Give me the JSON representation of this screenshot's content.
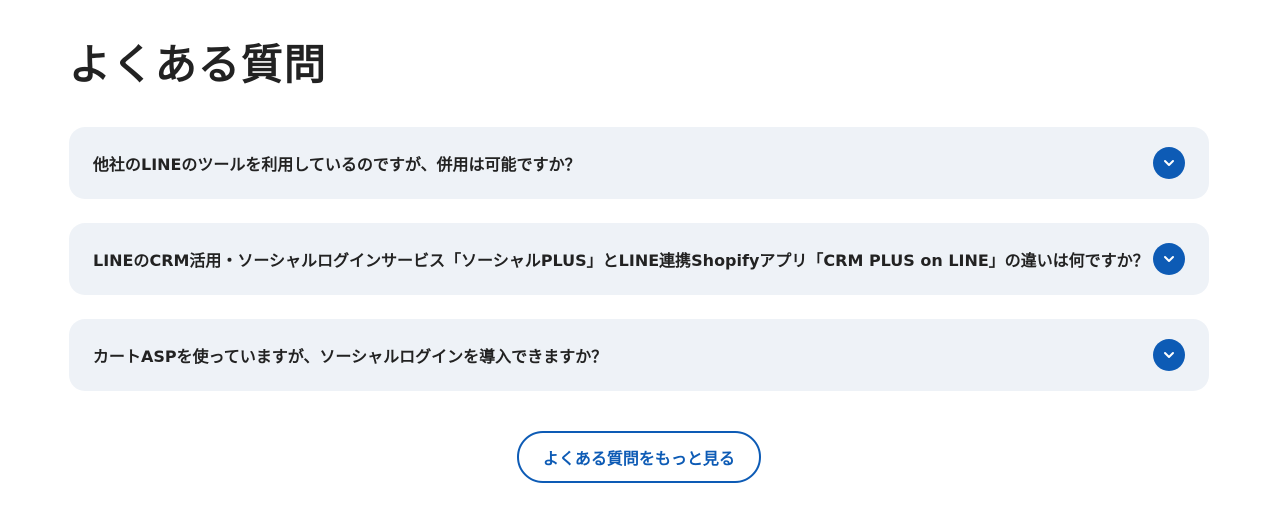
{
  "faq": {
    "title": "よくある質問",
    "items": [
      {
        "question": "他社のLINEのツールを利用しているのですが、併用は可能ですか？",
        "icon": "chevron-down-icon"
      },
      {
        "question": "LINEのCRM活用・ソーシャルログインサービス「ソーシャルPLUS」とLINE連携Shopifyアプリ「CRM PLUS on LINE」の違いは何ですか？",
        "icon": "chevron-down-icon"
      },
      {
        "question": "カートASPを使っていますが、ソーシャルログインを導入できますか？",
        "icon": "chevron-down-icon"
      }
    ],
    "more_label": "よくある質問をもっと見る"
  },
  "colors": {
    "accent": "#0d5bb5",
    "item_background": "#eef2f7",
    "text": "#222222"
  }
}
